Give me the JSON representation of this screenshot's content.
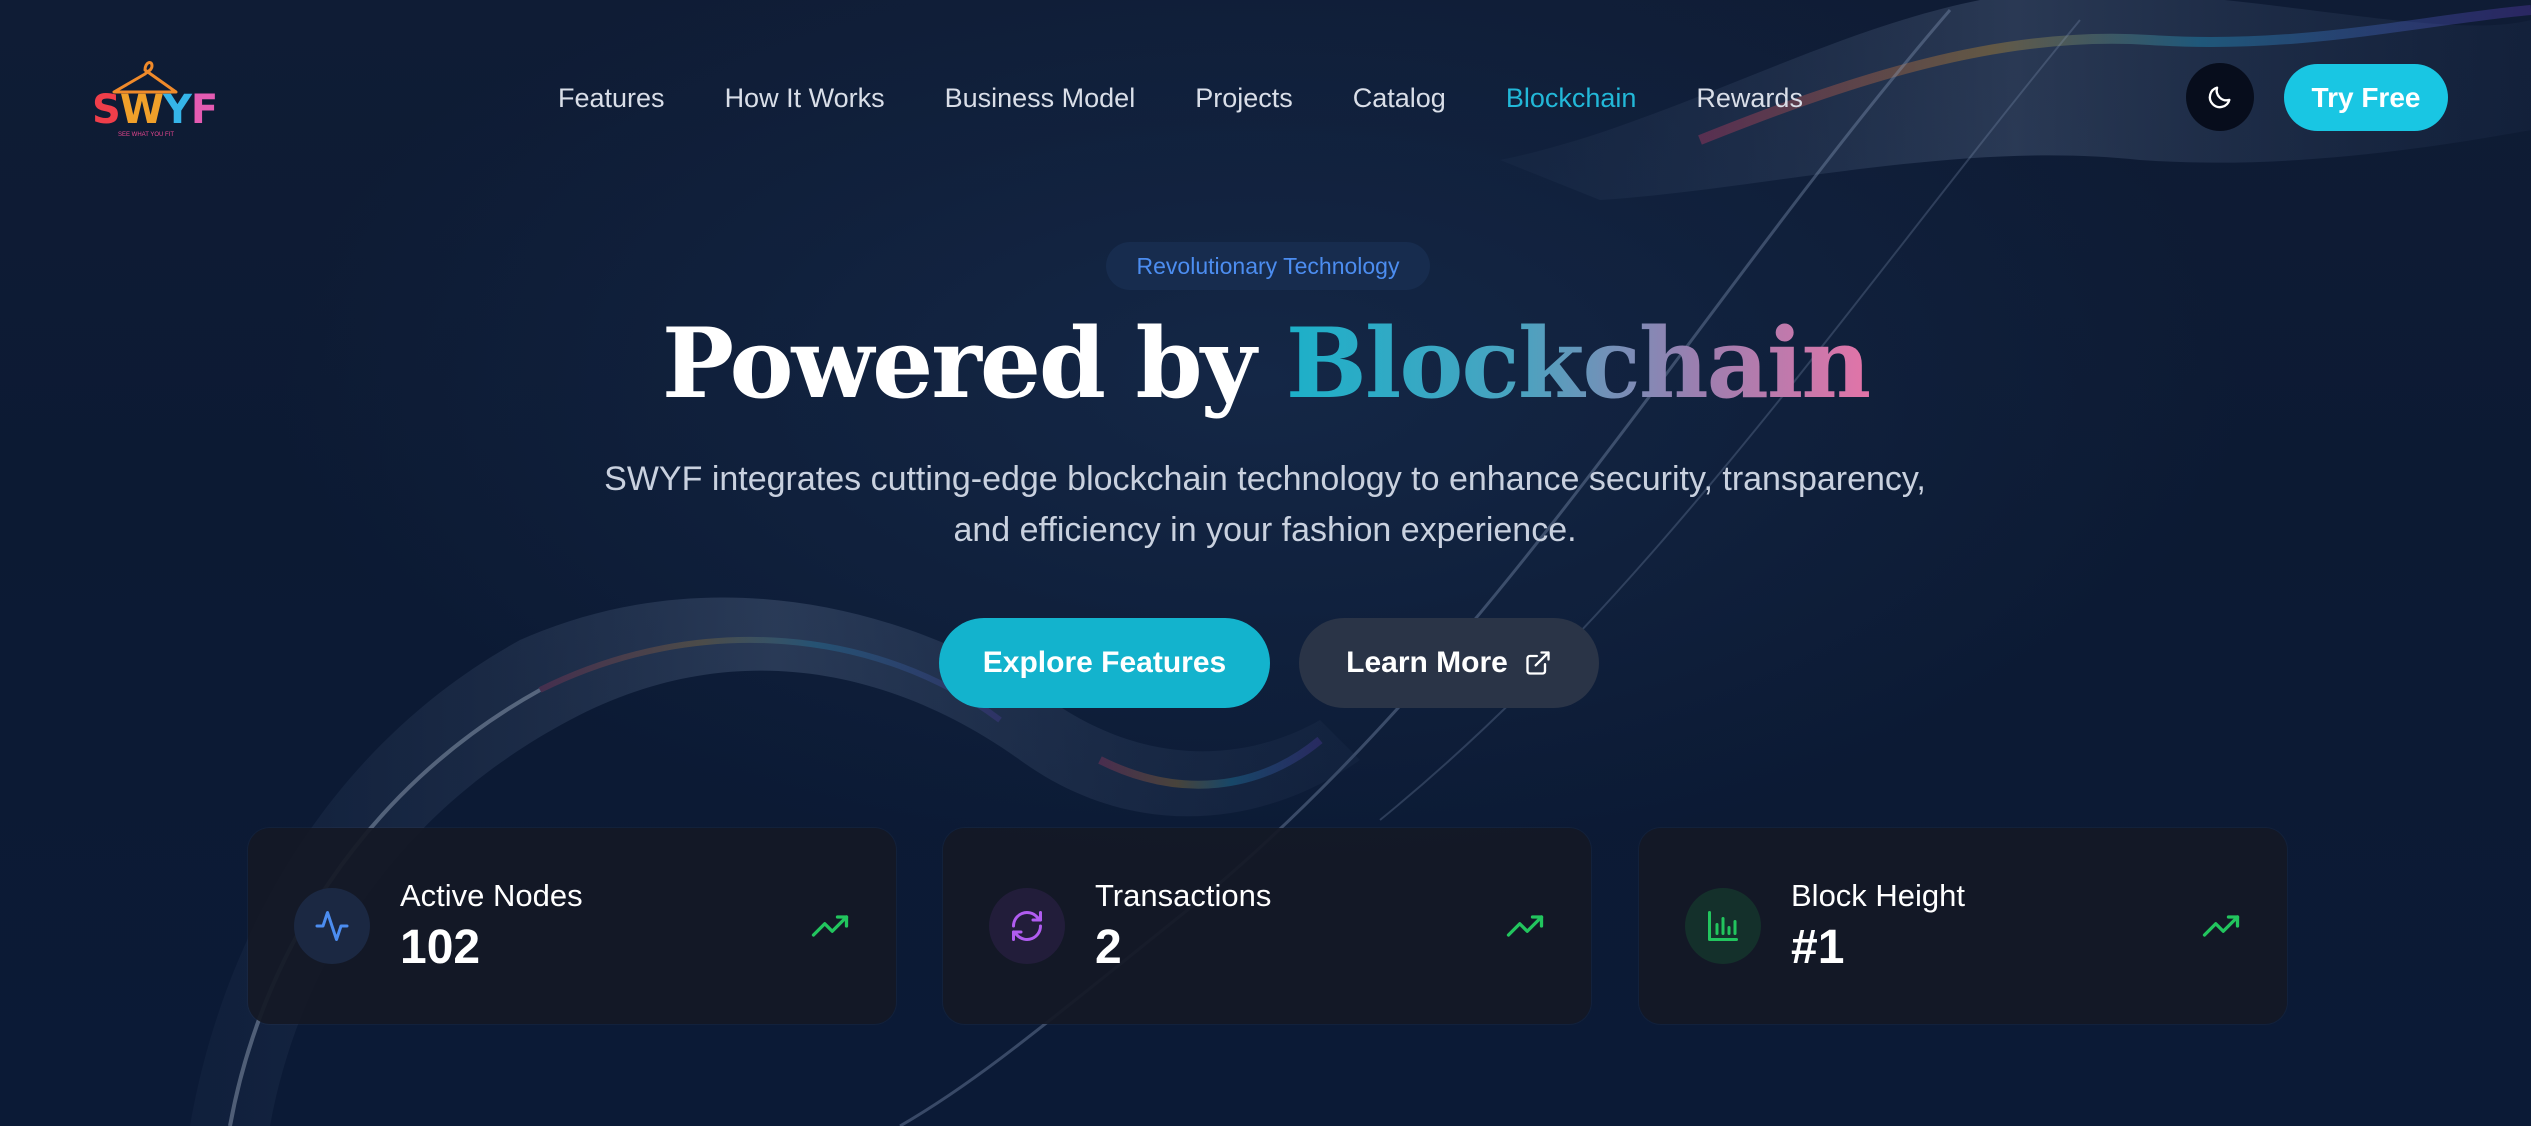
{
  "brand": {
    "logo_text": [
      "S",
      "W",
      "Y",
      "F"
    ],
    "tagline": "SEE WHAT YOU FIT"
  },
  "nav": {
    "items": [
      {
        "label": "Features",
        "active": false
      },
      {
        "label": "How It Works",
        "active": false
      },
      {
        "label": "Business Model",
        "active": false
      },
      {
        "label": "Projects",
        "active": false
      },
      {
        "label": "Catalog",
        "active": false
      },
      {
        "label": "Blockchain",
        "active": true
      },
      {
        "label": "Rewards",
        "active": false
      }
    ],
    "theme_toggle_icon": "moon-icon",
    "cta_label": "Try Free"
  },
  "hero": {
    "badge": "Revolutionary Technology",
    "title_plain": "Powered by",
    "title_accent": "Blockchain",
    "subtitle_line1": "SWYF integrates cutting-edge blockchain technology to enhance security, transparency,",
    "subtitle_line2": "and efficiency in your fashion experience.",
    "primary_button": "Explore Features",
    "secondary_button": "Learn More",
    "secondary_button_icon": "external-link-icon"
  },
  "stats": [
    {
      "label": "Active Nodes",
      "value": "102",
      "icon": "activity-icon",
      "icon_color": "#4c8df0",
      "trend_icon": "trending-up-icon"
    },
    {
      "label": "Transactions",
      "value": "2",
      "icon": "refresh-icon",
      "icon_color": "#b05cf0",
      "trend_icon": "trending-up-icon"
    },
    {
      "label": "Block Height",
      "value": "#1",
      "icon": "bar-chart-icon",
      "icon_color": "#22c55e",
      "trend_icon": "trending-up-icon"
    }
  ],
  "colors": {
    "accent": "#19c6e3",
    "background": "#0c1a33",
    "trend": "#22c55e"
  }
}
